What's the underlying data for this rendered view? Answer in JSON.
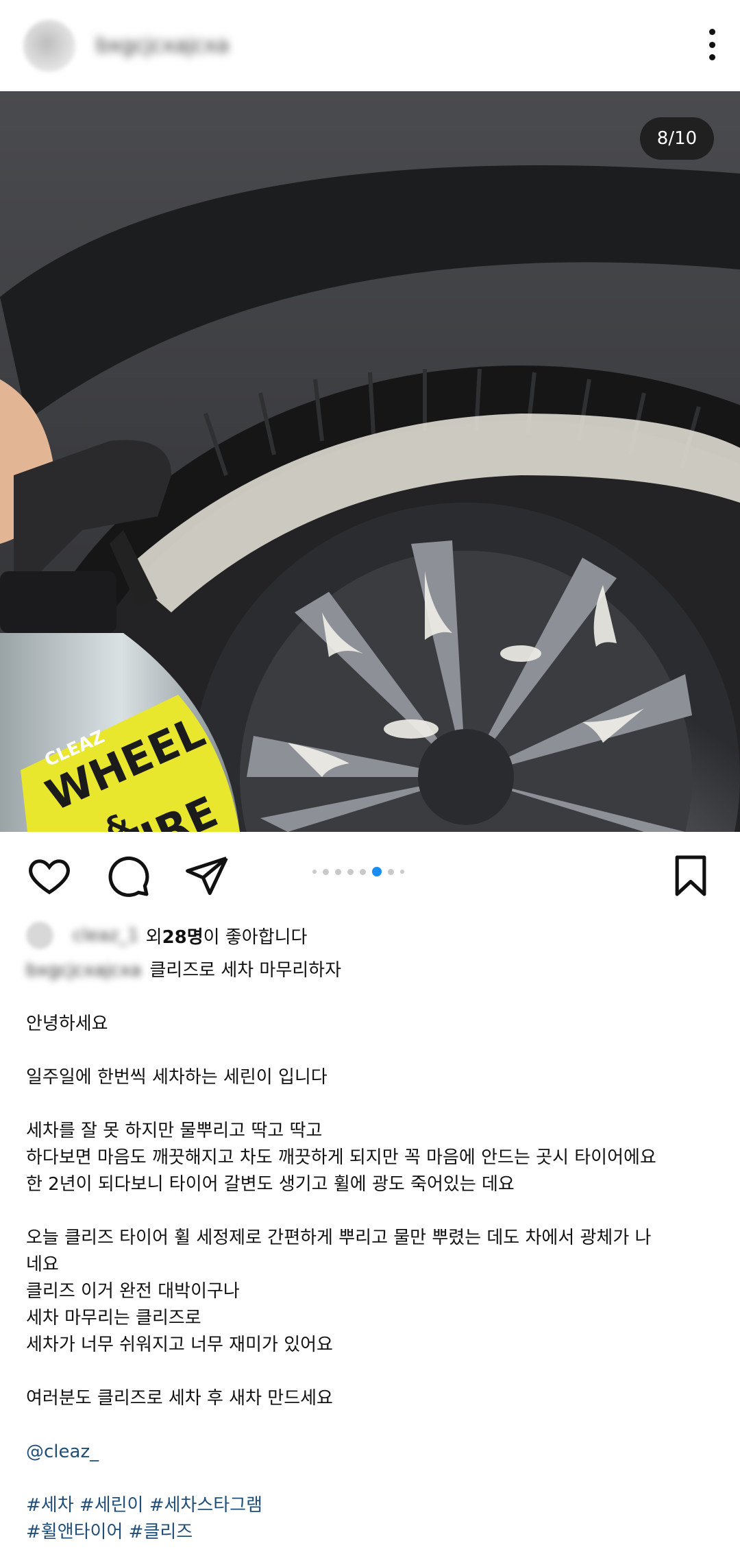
{
  "header": {
    "username": "bxgcjcxajcxa",
    "more_icon": "more-vertical-icon"
  },
  "post": {
    "counter": "8/10",
    "image_description_icon": "photo"
  },
  "actions": {
    "like_icon": "heart-icon",
    "comment_icon": "comment-icon",
    "share_icon": "send-icon",
    "save_icon": "bookmark-icon",
    "carousel_active_index": 5
  },
  "likes": {
    "liker": "cleaz_1",
    "prefix": "외 ",
    "count": "28명",
    "suffix": "이 좋아합니다"
  },
  "caption": {
    "username": "bxgcjcxajcxa",
    "title": "클리즈로 세차 마무리하자",
    "line1": "안녕하세요",
    "line2": "일주일에 한번씩 세차하는 세린이 입니다",
    "line3": "세차를 잘 못 하지만 물뿌리고 딱고 딱고",
    "line4": "하다보면 마음도  깨끗해지고 차도 깨끗하게 되지만 꼭 마음에 안드는 곳시 타이어에요",
    "line5": "한 2년이 되다보니 타이어 갈변도 생기고 휠에 광도 죽어있는 데요",
    "line6": "오늘 클리즈  타이어 휠 세정제로 간편하게 뿌리고 물만  뿌렸는 데도 차에서 광체가 나",
    "line7": "네요",
    "line8": "클리즈 이거 완전 대박이구나",
    "line9": "세차 마무리는 클리즈로",
    "line10": "세차가 너무 쉬워지고 너무 재미가 있어요",
    "line11": "여러분도 클리즈로 세차 후 새차 만드세요",
    "mention": "@cleaz_",
    "tag1": "#세차",
    "tag2": "#세린이",
    "tag3": "#세차스타그램",
    "tag4": "#휠앤타이어",
    "tag5": "#클리즈"
  },
  "photo": {
    "brand": "CLEAZ",
    "product_line1": "WHEEL",
    "product_amp": "&",
    "product_line2": "TIRE"
  }
}
